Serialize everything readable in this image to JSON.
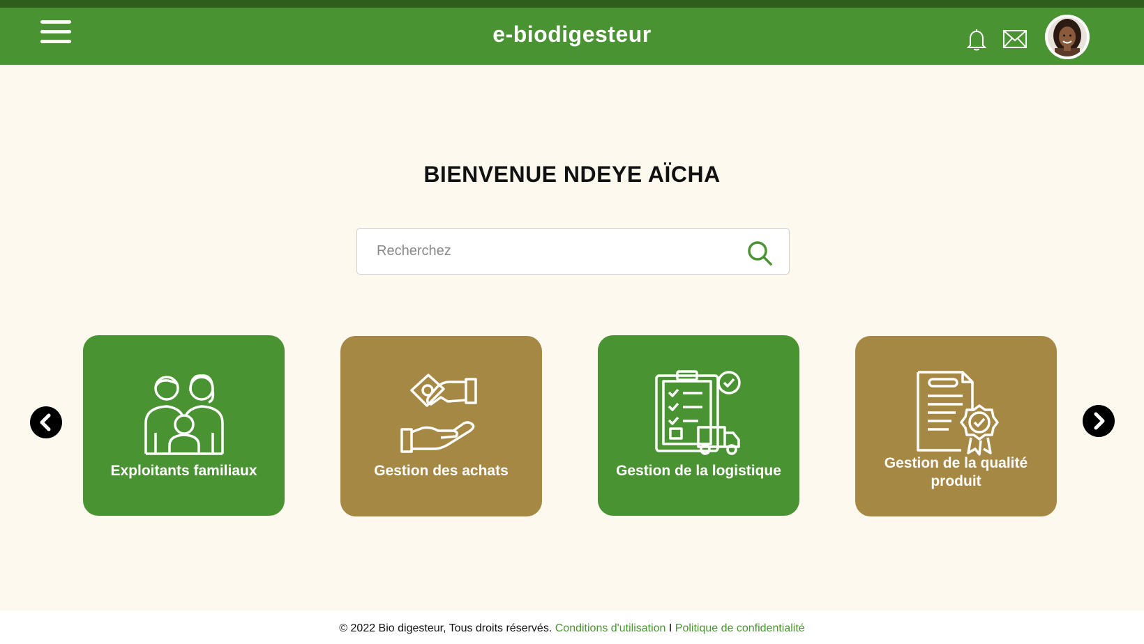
{
  "header": {
    "title": "e-biodigesteur",
    "menu_icon": "hamburger-menu-icon",
    "notification_icon": "bell-icon",
    "messages_icon": "envelope-icon",
    "avatar_icon": "user-avatar"
  },
  "main": {
    "welcome": "BIENVENUE NDEYE AÏCHA",
    "search": {
      "placeholder": "Recherchez",
      "value": "",
      "icon": "search-icon"
    },
    "cards": [
      {
        "label": "Exploitants familiaux",
        "icon": "family-icon",
        "color": "#4a9332"
      },
      {
        "label": "Gestion des achats",
        "icon": "handshake-money-icon",
        "color": "#a68845"
      },
      {
        "label": "Gestion de la logistique",
        "icon": "logistics-checklist-icon",
        "color": "#4a9332"
      },
      {
        "label": "Gestion de la qualité produit",
        "icon": "certificate-icon",
        "color": "#a68845"
      }
    ],
    "prev_icon": "chevron-left-icon",
    "next_icon": "chevron-right-icon"
  },
  "footer": {
    "copyright": "© 2022 Bio digesteur, Tous droits réservés.",
    "terms": "Conditions d'utilisation",
    "separator": "I",
    "privacy": "Politique de confidentialité"
  },
  "colors": {
    "primary_green": "#4a9332",
    "dark_green": "#2f5e1c",
    "brown": "#a68845",
    "background": "#fdf9ee"
  }
}
